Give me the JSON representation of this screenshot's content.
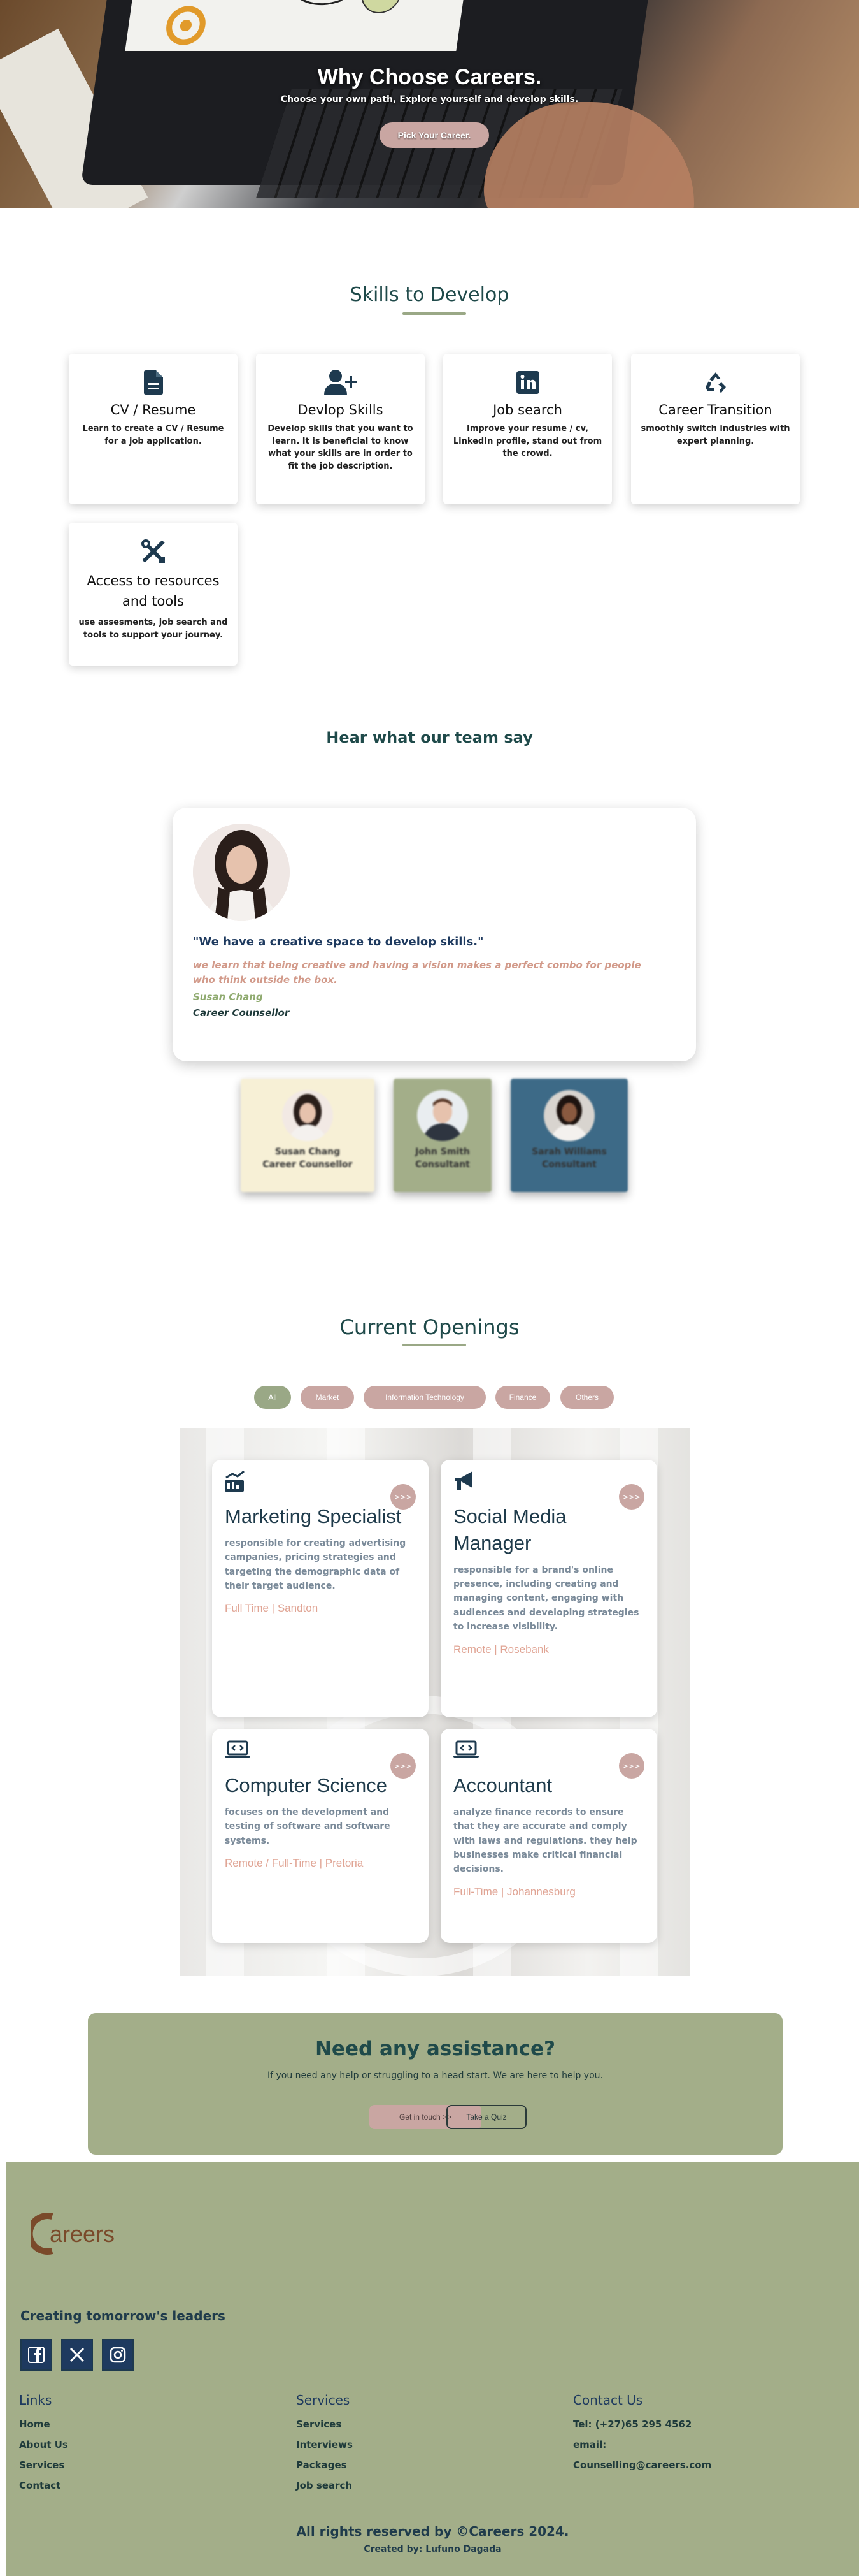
{
  "hero": {
    "title": "Why Choose Careers.",
    "subtitle": "Choose your own path, Explore yourself and develop skills.",
    "button": "Pick Your Career."
  },
  "skills": {
    "title": "Skills to Develop",
    "cards": [
      {
        "icon": "file-icon",
        "title": "CV / Resume",
        "desc": "Learn to create a CV / Resume for a job application."
      },
      {
        "icon": "user-plus-icon",
        "title": "Devlop Skills",
        "desc": "Develop skills that you want to learn. It is beneficial to know what your skills are in order to fit the job description."
      },
      {
        "icon": "linkedin-icon",
        "title": "Job search",
        "desc": "Improve your resume / cv, LinkedIn profile, stand out from the crowd."
      },
      {
        "icon": "recycle-icon",
        "title": "Career Transition",
        "desc": "smoothly switch industries with expert planning."
      },
      {
        "icon": "tools-icon",
        "title": "Access to resources and tools",
        "desc": "use assesments, job search and tools to support your journey."
      }
    ]
  },
  "testimonials": {
    "title": "Hear what our team say",
    "featured": {
      "quote": "\"We have a creative space to develop skills.\"",
      "text": "we learn that being creative and having a vision makes a perfect combo for people who think outside the box.",
      "name": "Susan Chang",
      "role": "Career Counsellor"
    },
    "thumbs": [
      {
        "name": "Susan Chang",
        "role": "Career Counsellor",
        "bg": "#f7f0d6"
      },
      {
        "name": "John Smith",
        "role": "Consultant",
        "bg": "#a3ae89"
      },
      {
        "name": "Sarah Williams",
        "role": "Consultant",
        "bg": "#3d6a87"
      }
    ]
  },
  "openings": {
    "title": "Current Openings",
    "filters": [
      "All",
      "Market",
      "Information Technology",
      "Finance",
      "Others"
    ],
    "active_filter": "All",
    "go_label": ">>>",
    "jobs": [
      {
        "icon": "chart-icon",
        "title": "Marketing Specialist",
        "desc": "responsible for creating advertising campanies, pricing strategies and targeting the demographic data of their target audience.",
        "location": "Full Time | Sandton"
      },
      {
        "icon": "megaphone-icon",
        "title": "Social Media Manager",
        "desc": "responsible for a brand's online presence, including creating and managing content, engaging with audiences and developing strategies to increase visibility.",
        "location": "Remote | Rosebank"
      },
      {
        "icon": "laptop-code-icon",
        "title": "Computer Science",
        "desc": "focuses on the development and testing of software and software systems.",
        "location": "Remote / Full-Time | Pretoria"
      },
      {
        "icon": "laptop-code-icon",
        "title": "Accountant",
        "desc": "analyze finance records to ensure that they are accurate and comply with laws and regulations. they help businesses make critical financial decisions.",
        "location": "Full-Time | Johannesburg"
      }
    ]
  },
  "assist": {
    "title": "Need any assistance?",
    "text": "If you need any help or struggling to a head start. We are here to help you.",
    "touch": "Get in touch >>",
    "quiz": "Take a Quiz"
  },
  "footer": {
    "logo": "Careers",
    "tagline": "Creating tomorrow's leaders",
    "links_title": "Links",
    "links": [
      "Home",
      "About Us",
      "Services",
      "Contact"
    ],
    "services_title": "Services",
    "services": [
      "Services",
      "Interviews",
      "Packages",
      "Job search"
    ],
    "contact_title": "Contact Us",
    "contact": [
      "Tel: (+27)65 295 4562",
      "email:",
      "Counselling@careers.com"
    ],
    "copyright": "All rights reserved by ©Careers 2024.",
    "credit": "Created by: Lufuno Dagada"
  }
}
